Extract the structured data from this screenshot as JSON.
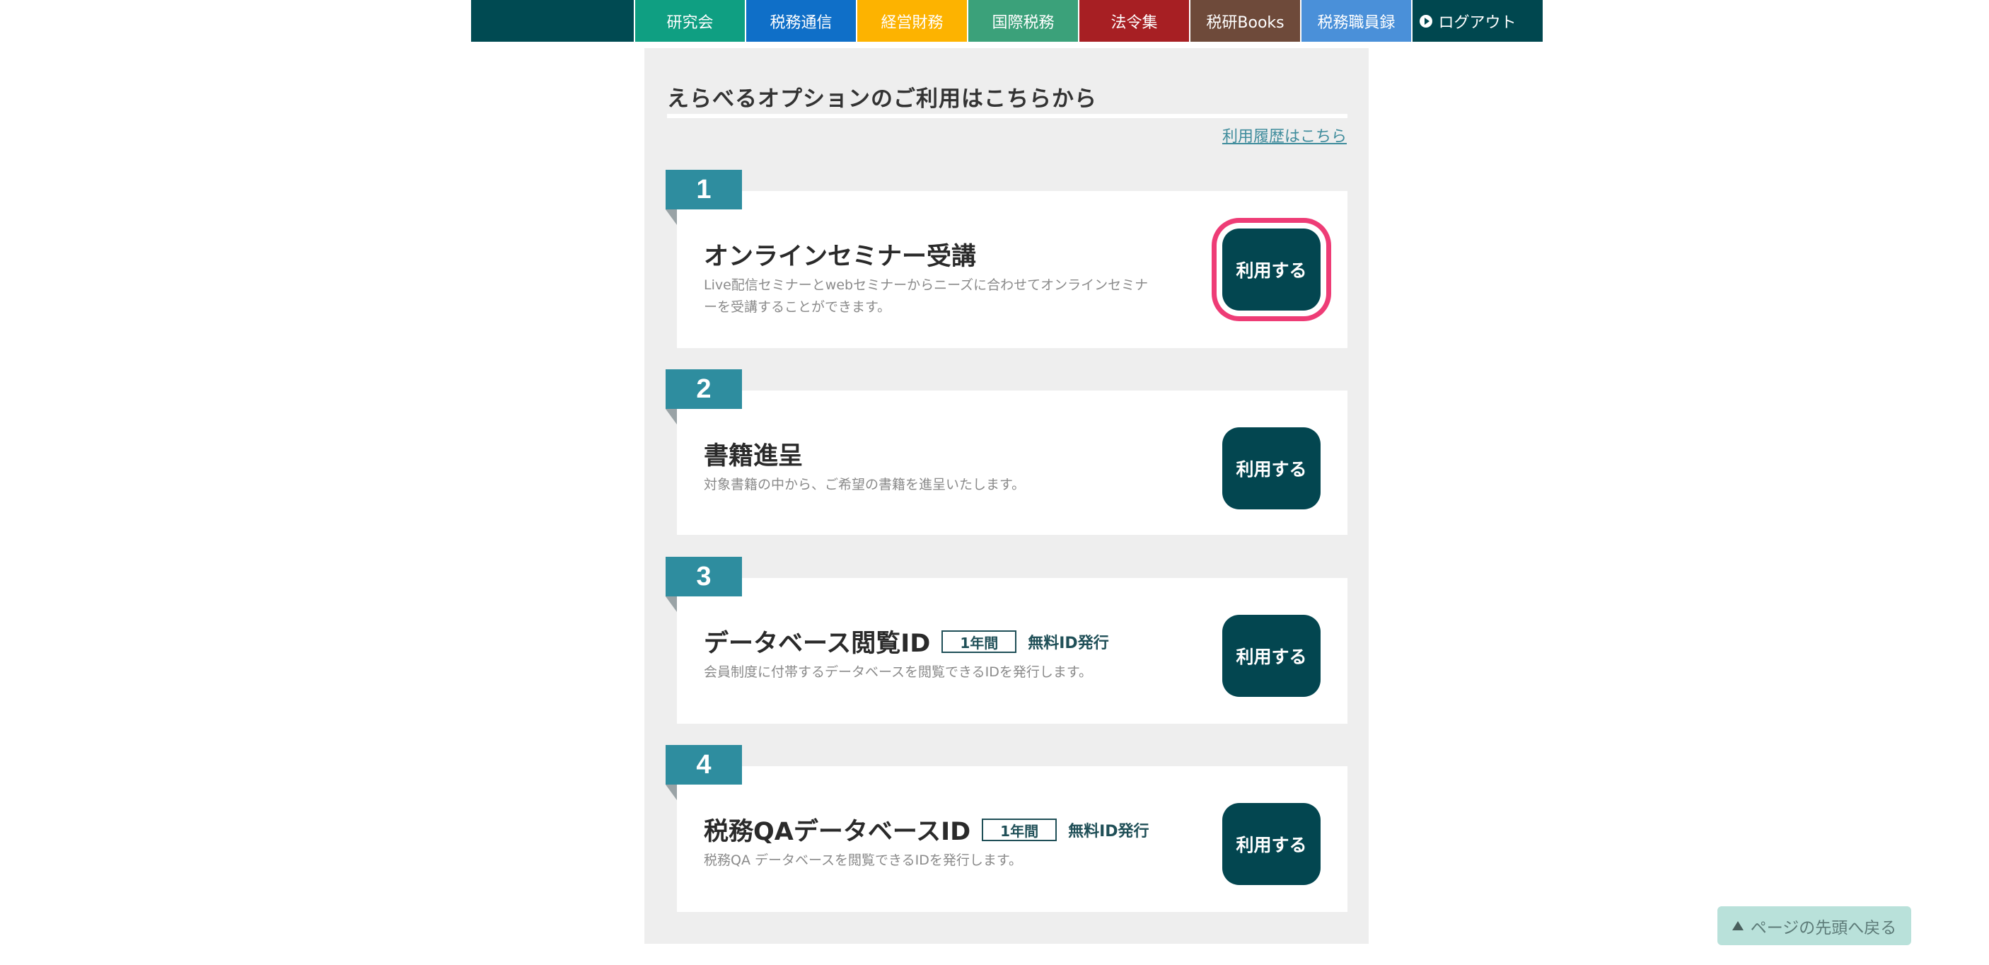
{
  "nav": {
    "items": [
      {
        "label": "研究会",
        "color": "#0f9f82"
      },
      {
        "label": "税務通信",
        "color": "#0f6fc8"
      },
      {
        "label": "経営財務",
        "color": "#fdb300"
      },
      {
        "label": "国際税務",
        "color": "#3ba17a"
      },
      {
        "label": "法令集",
        "color": "#a71f23"
      },
      {
        "label": "税研Books",
        "color": "#6e4a3a"
      },
      {
        "label": "税務職員録",
        "color": "#4a90d9"
      }
    ],
    "logout": {
      "label": "ログアウト",
      "icon": "play-circle-icon"
    }
  },
  "panel": {
    "title": "えらべるオプションのご利用はこちらから",
    "history_link": "利用履歴はこちら"
  },
  "cards": [
    {
      "number": "1",
      "title": "オンラインセミナー受講",
      "description": "Live配信セミナーとwebセミナーからニーズに合わせてオンラインセミナーを受講することができます。",
      "button": "利用する",
      "highlighted": true
    },
    {
      "number": "2",
      "title": "書籍進呈",
      "description": "対象書籍の中から、ご希望の書籍を進呈いたします。",
      "button": "利用する"
    },
    {
      "number": "3",
      "title": "データベース閲覧ID",
      "badge": "1年間",
      "free_id": "無料ID発行",
      "description": "会員制度に付帯するデータベースを閲覧できるIDを発行します。",
      "button": "利用する"
    },
    {
      "number": "4",
      "title": "税務QAデータベースID",
      "badge": "1年間",
      "free_id": "無料ID発行",
      "description": "税務QA データベースを閲覧できるIDを発行します。",
      "button": "利用する"
    }
  ],
  "back_to_top": {
    "label": "ページの先頭へ戻る",
    "icon": "triangle-up-icon"
  },
  "colors": {
    "nav_dark": "#00474f",
    "button": "#034650",
    "number_tab": "#2e8d9f",
    "highlight_ring": "#ee3c76",
    "panel_bg": "#eeeeee"
  }
}
